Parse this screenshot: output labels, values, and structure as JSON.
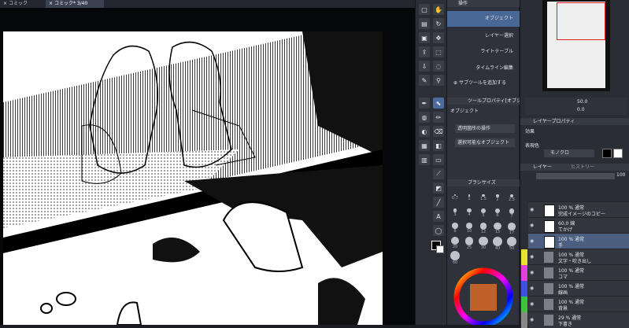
{
  "tabs": [
    {
      "label": "コミック"
    },
    {
      "label": "コミック* 3/40"
    }
  ],
  "subtool": {
    "header": "操作",
    "items": [
      {
        "label": "オブジェクト"
      },
      {
        "label": "レイヤー選択"
      },
      {
        "label": "ライトテーブル"
      },
      {
        "label": "タイムライン編集"
      }
    ],
    "add_label": "サブツールを追加する"
  },
  "tool_property": {
    "header": "ツールプロパティ[オブジェ",
    "title": "オブジェクト",
    "dropdown1": "透明箇所の操作",
    "dropdown2": "選択可能なオブジェクト"
  },
  "brush_size": {
    "header": "ブラシサイズ",
    "values": [
      "0.7",
      "1",
      "1.5",
      "2",
      "2.5",
      "3",
      "4",
      "5",
      "6",
      "7",
      "8",
      "10",
      "12",
      "15",
      "17",
      "20",
      "25",
      "30",
      "40",
      "50",
      "60"
    ]
  },
  "navigator": {
    "zoom": "50.0",
    "angle": "0.0"
  },
  "layer_property": {
    "header": "レイヤープロパティ",
    "effect_label": "効果",
    "display_label": "表現色",
    "display_value": "モノクロ"
  },
  "layers_panel": {
    "tab_layer": "レイヤー",
    "tab_history": "ヒストリー",
    "opacity": "100",
    "rows": [
      {
        "line1": "100 % 通常",
        "line2": "完成イメージのコピー"
      },
      {
        "line1": "60.0 線",
        "line2": "てかげ"
      },
      {
        "line1": "100 % 通常",
        "line2": "手"
      },
      {
        "line1": "100 % 通常",
        "line2": "文字・吹き出し"
      },
      {
        "line1": "100 % 通常",
        "line2": "コマ"
      },
      {
        "line1": "100 % 通常",
        "line2": "線画"
      },
      {
        "line1": "100 % 通常",
        "line2": "背景"
      },
      {
        "line1": "29 % 通常",
        "line2": "下書き"
      }
    ]
  },
  "colors": {
    "accent": "#4a6895",
    "panel": "#2f323a"
  }
}
